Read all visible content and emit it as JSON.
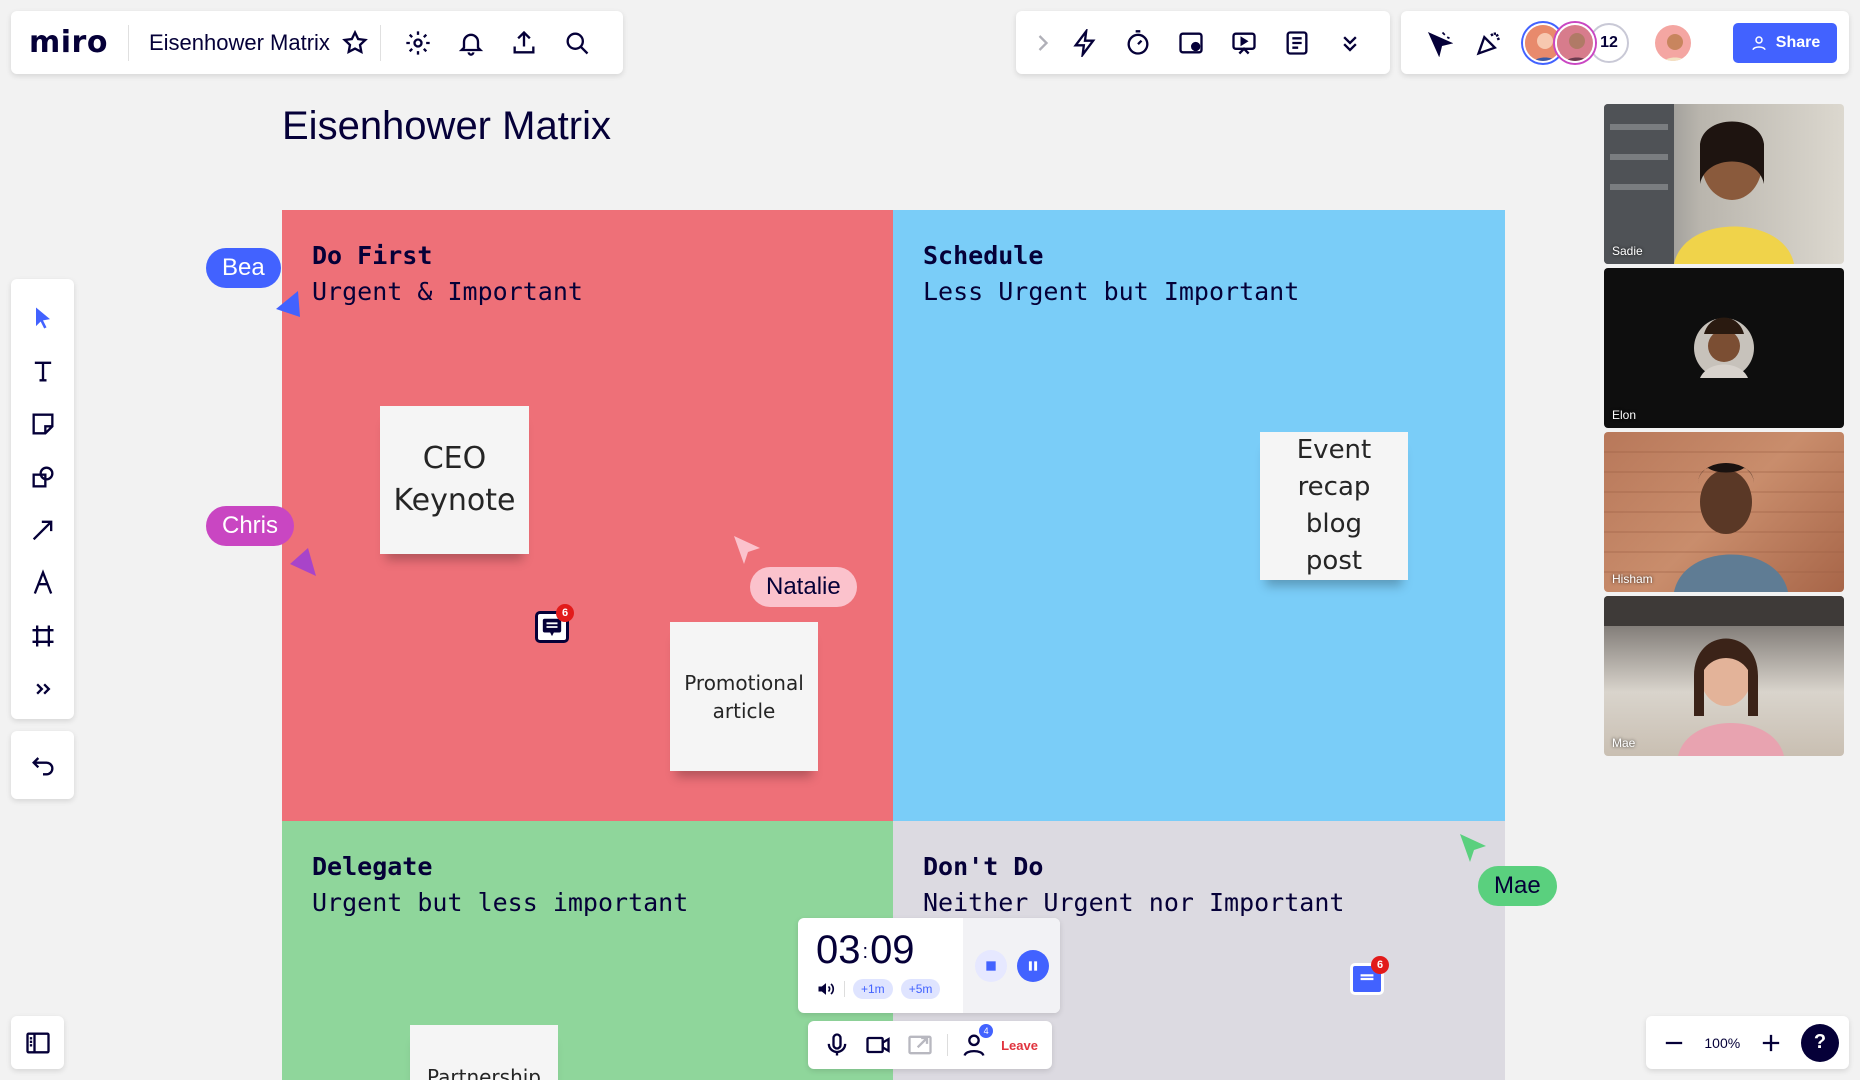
{
  "app": {
    "logo": "miro",
    "board_name": "Eisenhower Matrix"
  },
  "header": {
    "share_label": "Share",
    "collaborator_count": "12"
  },
  "board": {
    "title": "Eisenhower Matrix",
    "quadrants": [
      {
        "title": "Do First",
        "subtitle": "Urgent & Important",
        "color": "#ee7078"
      },
      {
        "title": "Schedule",
        "subtitle": "Less Urgent but Important",
        "color": "#7acdf8"
      },
      {
        "title": "Delegate",
        "subtitle": "Urgent but less important",
        "color": "#8fd69b"
      },
      {
        "title": "Don't Do",
        "subtitle": "Neither Urgent nor Important",
        "color": "#dcdae1"
      }
    ],
    "stickies": [
      {
        "text": "CEO Keynote"
      },
      {
        "text": "Promotional article"
      },
      {
        "text": "Event recap blog post"
      },
      {
        "text": "Partnership"
      }
    ],
    "cursors": [
      {
        "name": "Bea",
        "color": "#4262ff"
      },
      {
        "name": "Chris",
        "color": "#c946c2"
      },
      {
        "name": "Natalie",
        "color": "#fbc2cc"
      },
      {
        "name": "Mae",
        "color": "#5ad07e"
      }
    ],
    "comments": [
      {
        "count": "6"
      },
      {
        "count": "6"
      }
    ]
  },
  "timer": {
    "minutes": "03",
    "seconds": "09",
    "add_1": "+1m",
    "add_5": "+5m"
  },
  "call": {
    "leave_label": "Leave",
    "participants_badge": "4"
  },
  "zoom": {
    "level": "100%"
  },
  "video": [
    {
      "name": "Sadie"
    },
    {
      "name": "Elon"
    },
    {
      "name": "Hisham"
    },
    {
      "name": "Mae"
    }
  ]
}
